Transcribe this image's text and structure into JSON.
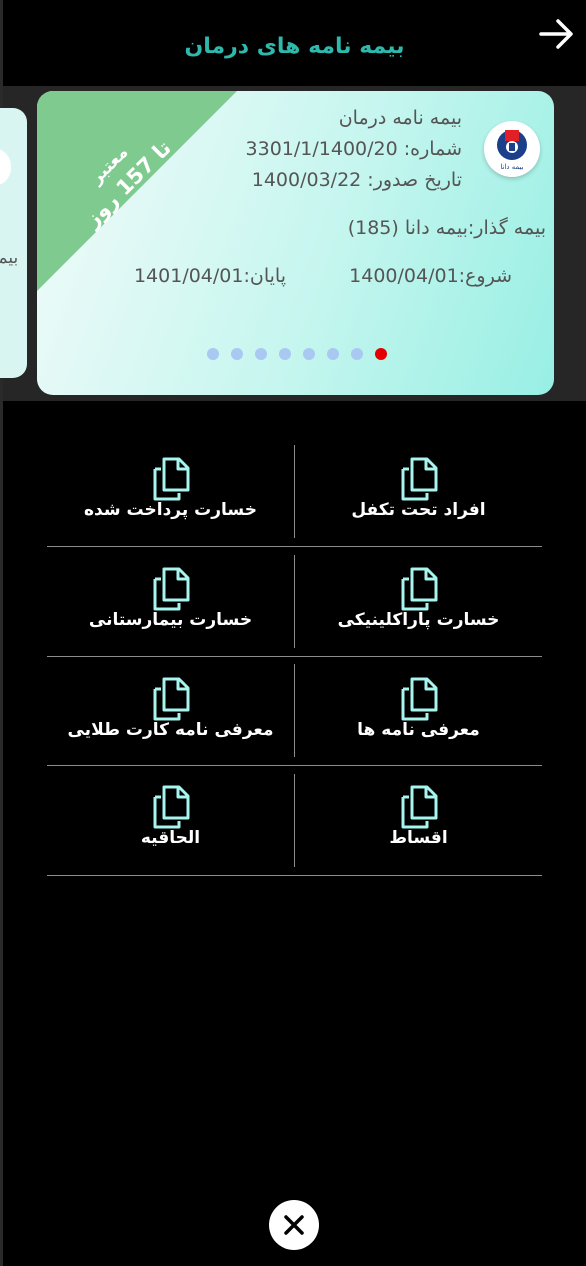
{
  "header": {
    "title": "بیمه نامه های درمان",
    "back_icon": "arrow-right-icon"
  },
  "peek_card": {
    "text": "بیم"
  },
  "card": {
    "type": "بیمه نامه درمان",
    "number_label": "شماره:",
    "number": "3301/1/1400/20",
    "issue_label": "تاریخ صدور:",
    "issue_date": "1400/03/22",
    "insurer": "بیمه گذار:بیمه دانا (185)",
    "start": "شروع:1400/04/01",
    "end": "پایان:1401/04/01",
    "badge_status": "معتبر",
    "badge_days": "تا 157 روز",
    "logo_caption": "بیمه دانا",
    "colors": {
      "ribbon": "#7fca8e",
      "card_start": "#f3fbfa",
      "card_end": "#98efe4"
    }
  },
  "pagination": {
    "total": 8,
    "active_index": 7
  },
  "menu": [
    {
      "label": "افراد تحت تکفل",
      "icon": "document-copy-icon"
    },
    {
      "label": "خسارت پرداخت شده",
      "icon": "document-copy-icon"
    },
    {
      "label": "خسارت پاراکلینیکی",
      "icon": "document-copy-icon"
    },
    {
      "label": "خسارت بیمارستانی",
      "icon": "document-copy-icon"
    },
    {
      "label": "معرفی نامه ها",
      "icon": "document-copy-icon"
    },
    {
      "label": "معرفی نامه کارت طلایی",
      "icon": "document-copy-icon"
    },
    {
      "label": "اقساط",
      "icon": "document-copy-icon"
    },
    {
      "label": "الحاقیه",
      "icon": "document-copy-icon"
    }
  ],
  "footer": {
    "close_icon": "close-icon"
  },
  "colors": {
    "accent": "#2fb9ad",
    "icon": "#a7f5ef",
    "dot": "#a9c8f2",
    "dot_active": "#e40000"
  }
}
